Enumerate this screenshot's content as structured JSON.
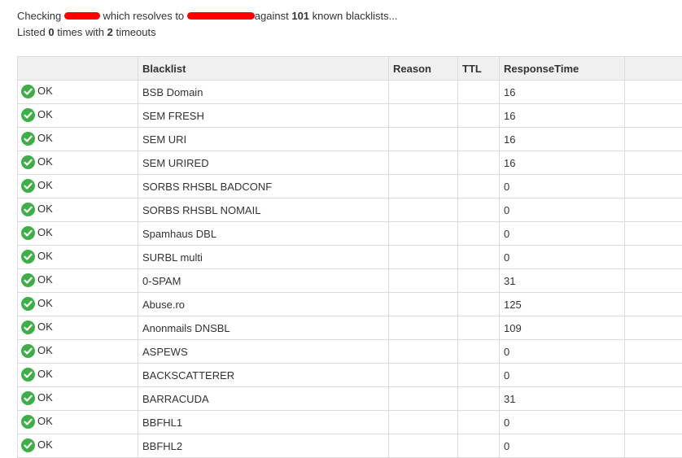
{
  "summary": {
    "checking_prefix": "Checking",
    "resolves_text": "which resolves to",
    "against_text": "against",
    "blacklist_count": "101",
    "known_text": "known blacklists...",
    "listed_prefix": "Listed",
    "listed_count": "0",
    "times_with_text": "times with",
    "timeout_count": "2",
    "timeouts_text": "timeouts"
  },
  "colors": {
    "redaction": "#ff0000",
    "ok_icon": "#3fae49",
    "header_bg": "#f0f0f0",
    "border": "#dcdcdc"
  },
  "table": {
    "columns": [
      "",
      "Blacklist",
      "Reason",
      "TTL",
      "ResponseTime",
      ""
    ],
    "status_icon": "check-circle-icon",
    "rows": [
      {
        "status": "OK",
        "blacklist": "BSB Domain",
        "reason": "",
        "ttl": "",
        "response_time": "16"
      },
      {
        "status": "OK",
        "blacklist": "SEM FRESH",
        "reason": "",
        "ttl": "",
        "response_time": "16"
      },
      {
        "status": "OK",
        "blacklist": "SEM URI",
        "reason": "",
        "ttl": "",
        "response_time": "16"
      },
      {
        "status": "OK",
        "blacklist": "SEM URIRED",
        "reason": "",
        "ttl": "",
        "response_time": "16"
      },
      {
        "status": "OK",
        "blacklist": "SORBS RHSBL BADCONF",
        "reason": "",
        "ttl": "",
        "response_time": "0"
      },
      {
        "status": "OK",
        "blacklist": "SORBS RHSBL NOMAIL",
        "reason": "",
        "ttl": "",
        "response_time": "0"
      },
      {
        "status": "OK",
        "blacklist": "Spamhaus DBL",
        "reason": "",
        "ttl": "",
        "response_time": "0"
      },
      {
        "status": "OK",
        "blacklist": "SURBL multi",
        "reason": "",
        "ttl": "",
        "response_time": "0"
      },
      {
        "status": "OK",
        "blacklist": "0-SPAM",
        "reason": "",
        "ttl": "",
        "response_time": "31"
      },
      {
        "status": "OK",
        "blacklist": "Abuse.ro",
        "reason": "",
        "ttl": "",
        "response_time": "125"
      },
      {
        "status": "OK",
        "blacklist": "Anonmails DNSBL",
        "reason": "",
        "ttl": "",
        "response_time": "109"
      },
      {
        "status": "OK",
        "blacklist": "ASPEWS",
        "reason": "",
        "ttl": "",
        "response_time": "0"
      },
      {
        "status": "OK",
        "blacklist": "BACKSCATTERER",
        "reason": "",
        "ttl": "",
        "response_time": "0"
      },
      {
        "status": "OK",
        "blacklist": "BARRACUDA",
        "reason": "",
        "ttl": "",
        "response_time": "31"
      },
      {
        "status": "OK",
        "blacklist": "BBFHL1",
        "reason": "",
        "ttl": "",
        "response_time": "0"
      },
      {
        "status": "OK",
        "blacklist": "BBFHL2",
        "reason": "",
        "ttl": "",
        "response_time": "0"
      }
    ]
  }
}
